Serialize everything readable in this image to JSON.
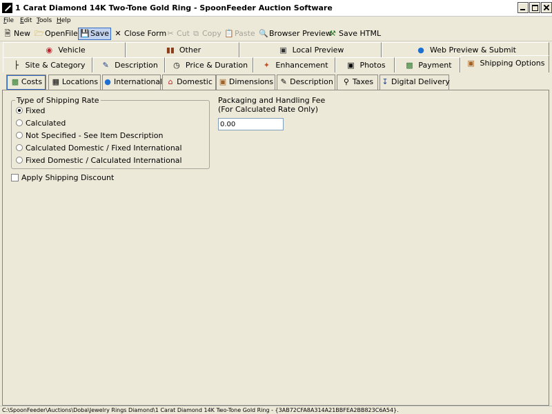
{
  "window": {
    "title": "1 Carat Diamond 14K Two-Tone Gold Ring - SpoonFeeder Auction Software"
  },
  "menu": [
    "File",
    "Edit",
    "Tools",
    "Help"
  ],
  "toolbar": {
    "new": "New",
    "open_file": "OpenFile",
    "save": "Save",
    "close_form": "Close Form",
    "cut": "Cut",
    "copy": "Copy",
    "paste": "Paste",
    "browser_preview": "Browser Preview",
    "save_html": "Save HTML"
  },
  "tabs_row1": [
    {
      "label": "Vehicle",
      "icon": "car-icon"
    },
    {
      "label": "Other",
      "icon": "barcode-icon"
    },
    {
      "label": "Local Preview",
      "icon": "monitor-icon"
    },
    {
      "label": "Web Preview & Submit",
      "icon": "globe-icon"
    }
  ],
  "tabs_row2": [
    {
      "label": "Site & Category",
      "icon": "tree-icon"
    },
    {
      "label": "Description",
      "icon": "document-icon"
    },
    {
      "label": "Price & Duration",
      "icon": "clock-icon"
    },
    {
      "label": "Enhancement",
      "icon": "wand-icon"
    },
    {
      "label": "Photos",
      "icon": "camera-icon"
    },
    {
      "label": "Payment",
      "icon": "money-icon"
    },
    {
      "label": "Shipping Options",
      "icon": "package-icon"
    }
  ],
  "tabs_row3": [
    {
      "label": "Costs",
      "icon": "money-icon"
    },
    {
      "label": "Locations",
      "icon": "building-icon"
    },
    {
      "label": "International",
      "icon": "globe-icon"
    },
    {
      "label": "Domestic",
      "icon": "house-icon"
    },
    {
      "label": "Dimensions",
      "icon": "box-icon"
    },
    {
      "label": "Description",
      "icon": "notes-icon"
    },
    {
      "label": "Taxes",
      "icon": "magnifier-icon"
    },
    {
      "label": "Digital Delivery",
      "icon": "download-icon"
    }
  ],
  "shipping_rate": {
    "title": "Type of Shipping Rate",
    "options": [
      "Fixed",
      "Calculated",
      "Not Specified - See Item Description",
      "Calculated Domestic / Fixed International",
      "Fixed Domestic / Calculated International"
    ],
    "selected": "Fixed"
  },
  "discount": {
    "label": "Apply Shipping Discount",
    "checked": false
  },
  "packaging_fee": {
    "label_line1": "Packaging and Handling Fee",
    "label_line2": "(For Calculated Rate Only)",
    "value": "0.00"
  },
  "status": {
    "path": "C:\\SpoonFeeder\\Auctions\\Doba\\Jewelry Rings Diamond\\1 Carat Diamond 14K Two-Tone Gold Ring - {3AB72CFA8A314A21BBFEA2BB823C6A54}."
  }
}
